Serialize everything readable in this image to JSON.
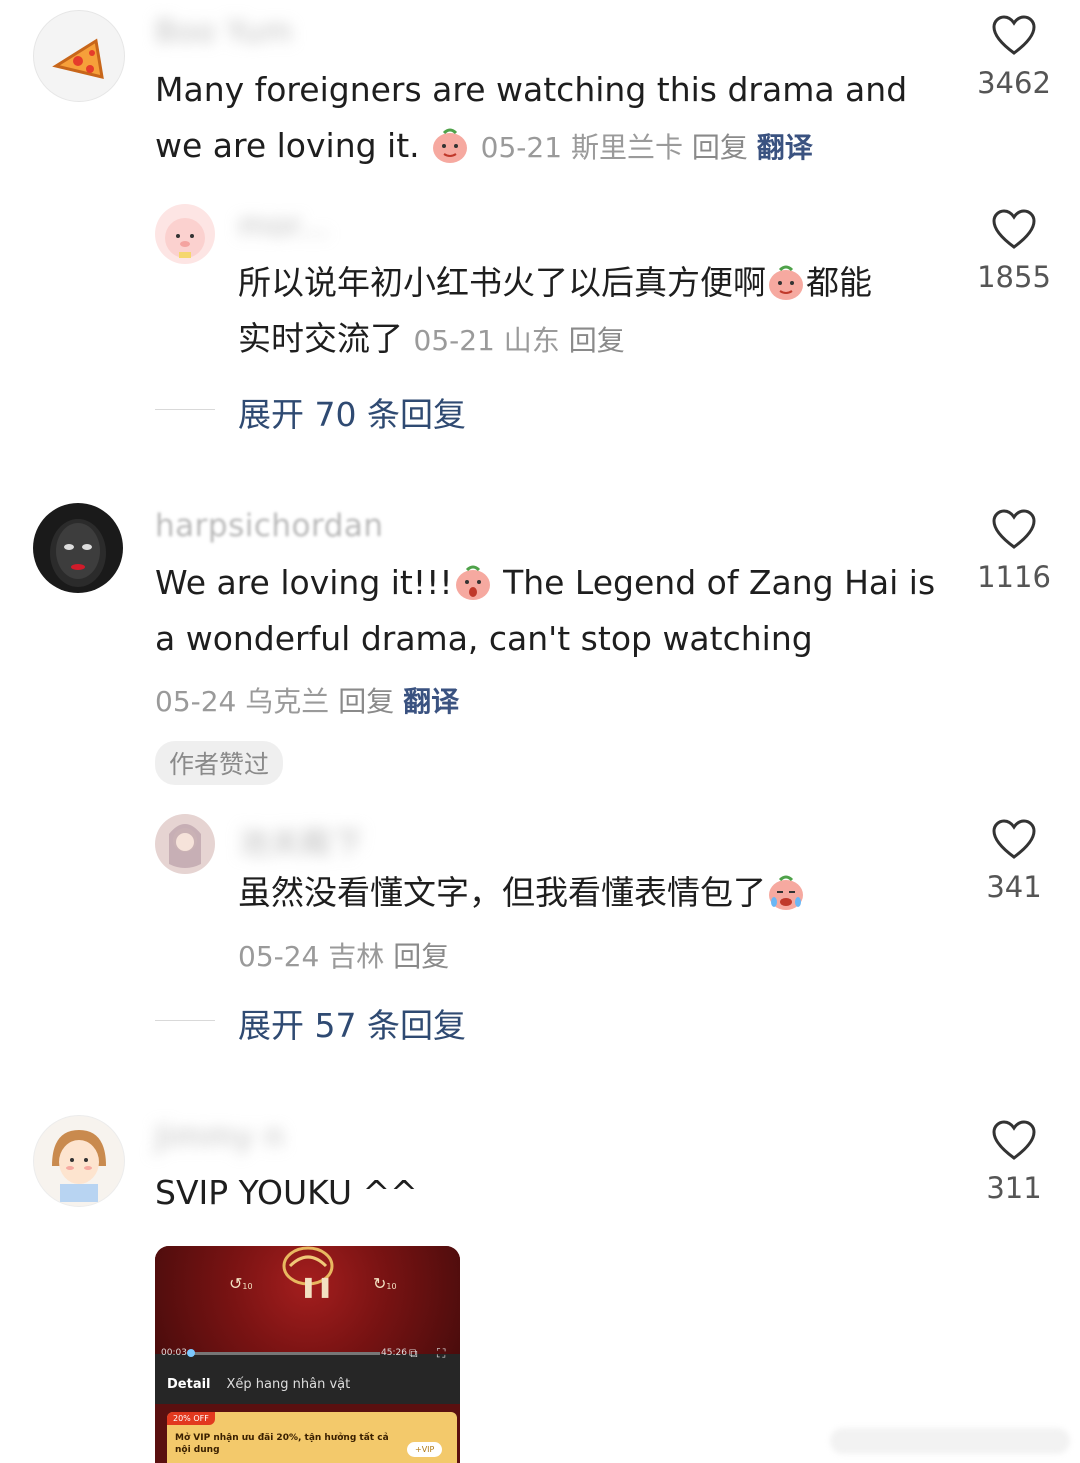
{
  "comments": [
    {
      "username": "Boo Yum",
      "text_line1": "Many foreigners are watching this drama and",
      "text_line2": "we are loving it.",
      "date": "05-21",
      "location": "斯里兰卡",
      "reply_label": "回复",
      "translate_label": "翻译",
      "likes": "3462",
      "replies": [
        {
          "username": "mor...",
          "text_line1a": "所以说年初小红书火了以后真方便啊",
          "text_line1b": "都能",
          "text_line2": "实时交流了",
          "date": "05-21",
          "location": "山东",
          "reply_label": "回复",
          "likes": "1855"
        }
      ],
      "expand_label": "展开 70 条回复"
    },
    {
      "username": "harpsichordan",
      "text_line1a": "We are loving it!!!",
      "text_line1b": "The Legend of Zang Hai is",
      "text_line2": "a  wonderful drama, can't stop watching",
      "date": "05-24",
      "location": "乌克兰",
      "reply_label": "回复",
      "translate_label": "翻译",
      "author_liked": "作者赞过",
      "likes": "1116",
      "replies": [
        {
          "username": "池关殿下",
          "text_line1": "虽然没看懂文字，但我看懂表情包了",
          "date": "05-24",
          "location": "吉林",
          "reply_label": "回复",
          "likes": "341"
        }
      ],
      "expand_label": "展开 57 条回复"
    },
    {
      "username": "Jimmy n",
      "text_line1": "SVIP YOUKU ^^",
      "likes": "311",
      "attachment": {
        "time_start": "00:03",
        "time_end": "45:26",
        "tab_active": "Detail",
        "tab_other": "Xếp hang nhân vật",
        "promo_tag": "20% OFF",
        "promo_text": "Mở VIP nhận ưu đãi 20%, tận hưởng tất cả nội dung",
        "vip_button": "+VIP",
        "rewind_label": "10",
        "forward_label": "10"
      }
    }
  ],
  "colors": {
    "link": "#2f4a72",
    "meta": "#9a9a9a",
    "heart": "#333333"
  },
  "icons": {
    "heart": "heart-outline-icon",
    "emoji": "pink-pig-sticker-icon"
  }
}
